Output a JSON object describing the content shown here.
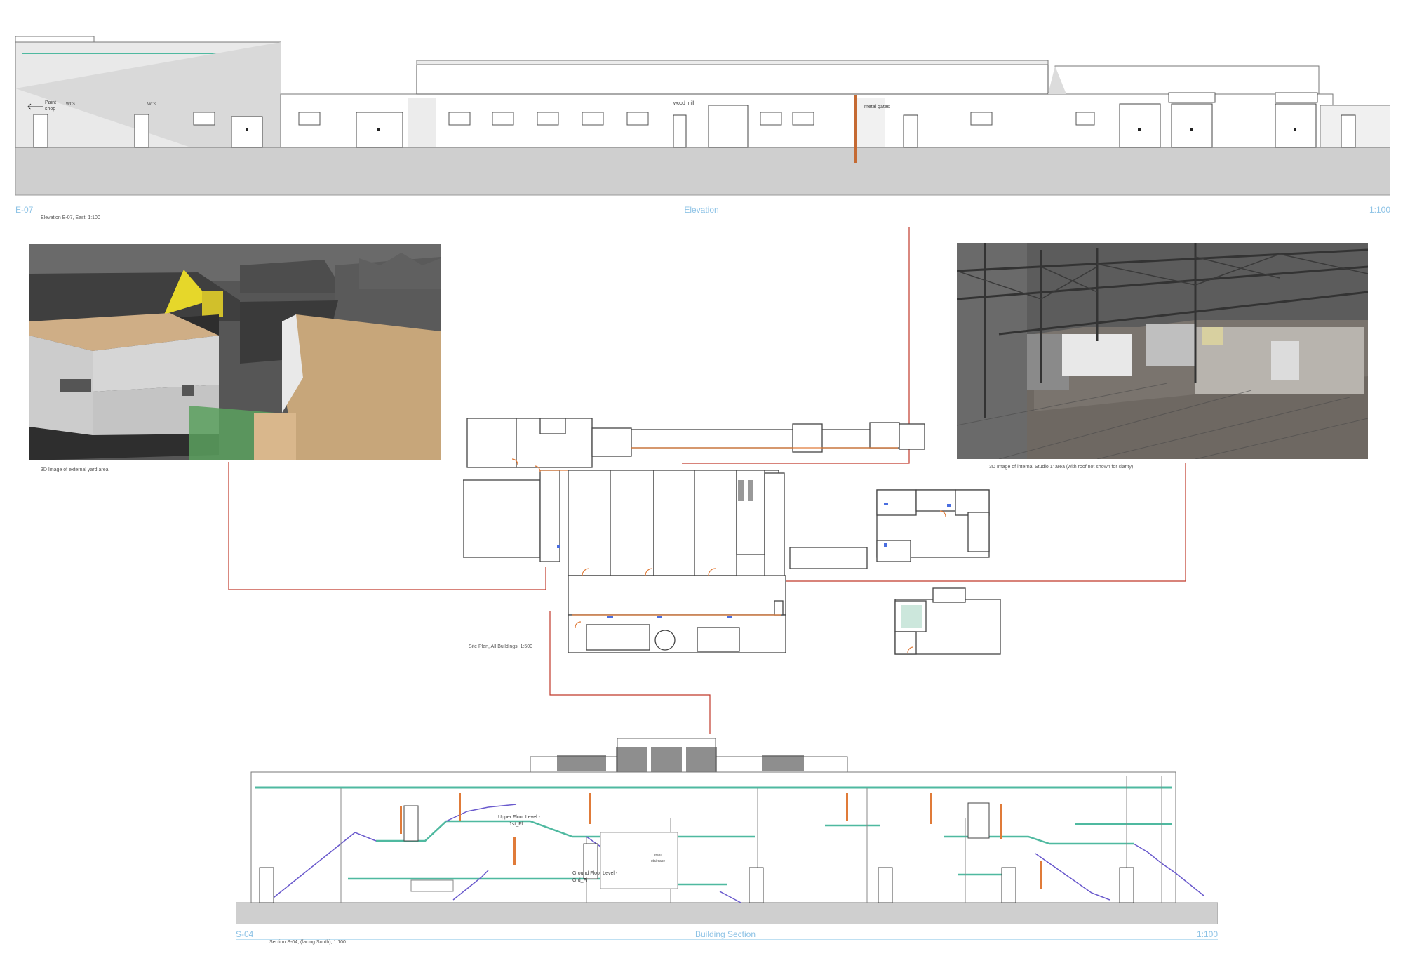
{
  "elevation": {
    "ref": "E-07",
    "title": "Elevation",
    "scale": "1:100",
    "caption": "Elevation E-07, East, 1:100",
    "labels": {
      "paint_shop_1": "Paint",
      "paint_shop_2": "shop",
      "wcs_1": "WCs",
      "wcs_2": "WCs",
      "wood_mill": "wood mill",
      "metal_gates": "metal gates"
    }
  },
  "render_left": {
    "caption": "3D Image of external yard area"
  },
  "render_right": {
    "caption": "3D Image of internal Studio 1' area (with roof not shown for clarity)"
  },
  "site_plan": {
    "caption": "Site Plan, All Buildings, 1:500"
  },
  "section": {
    "ref": "S-04",
    "title": "Building Section",
    "scale": "1:100",
    "caption": "Section S-04, (facing South), 1:100",
    "labels": {
      "upper_1": "Upper Floor Level -",
      "upper_2": "1st_Fl",
      "ground_1": "Ground Floor Level -",
      "ground_2": "Grd_Fl",
      "stair_1": "steel",
      "stair_2": "staircase"
    }
  },
  "colors": {
    "leader_red": "#c0392b",
    "titleblock_blue": "#8ec3e6",
    "door_orange": "#e07b39",
    "floor_teal": "#4fb9a0",
    "stair_purple": "#6a5acd"
  }
}
